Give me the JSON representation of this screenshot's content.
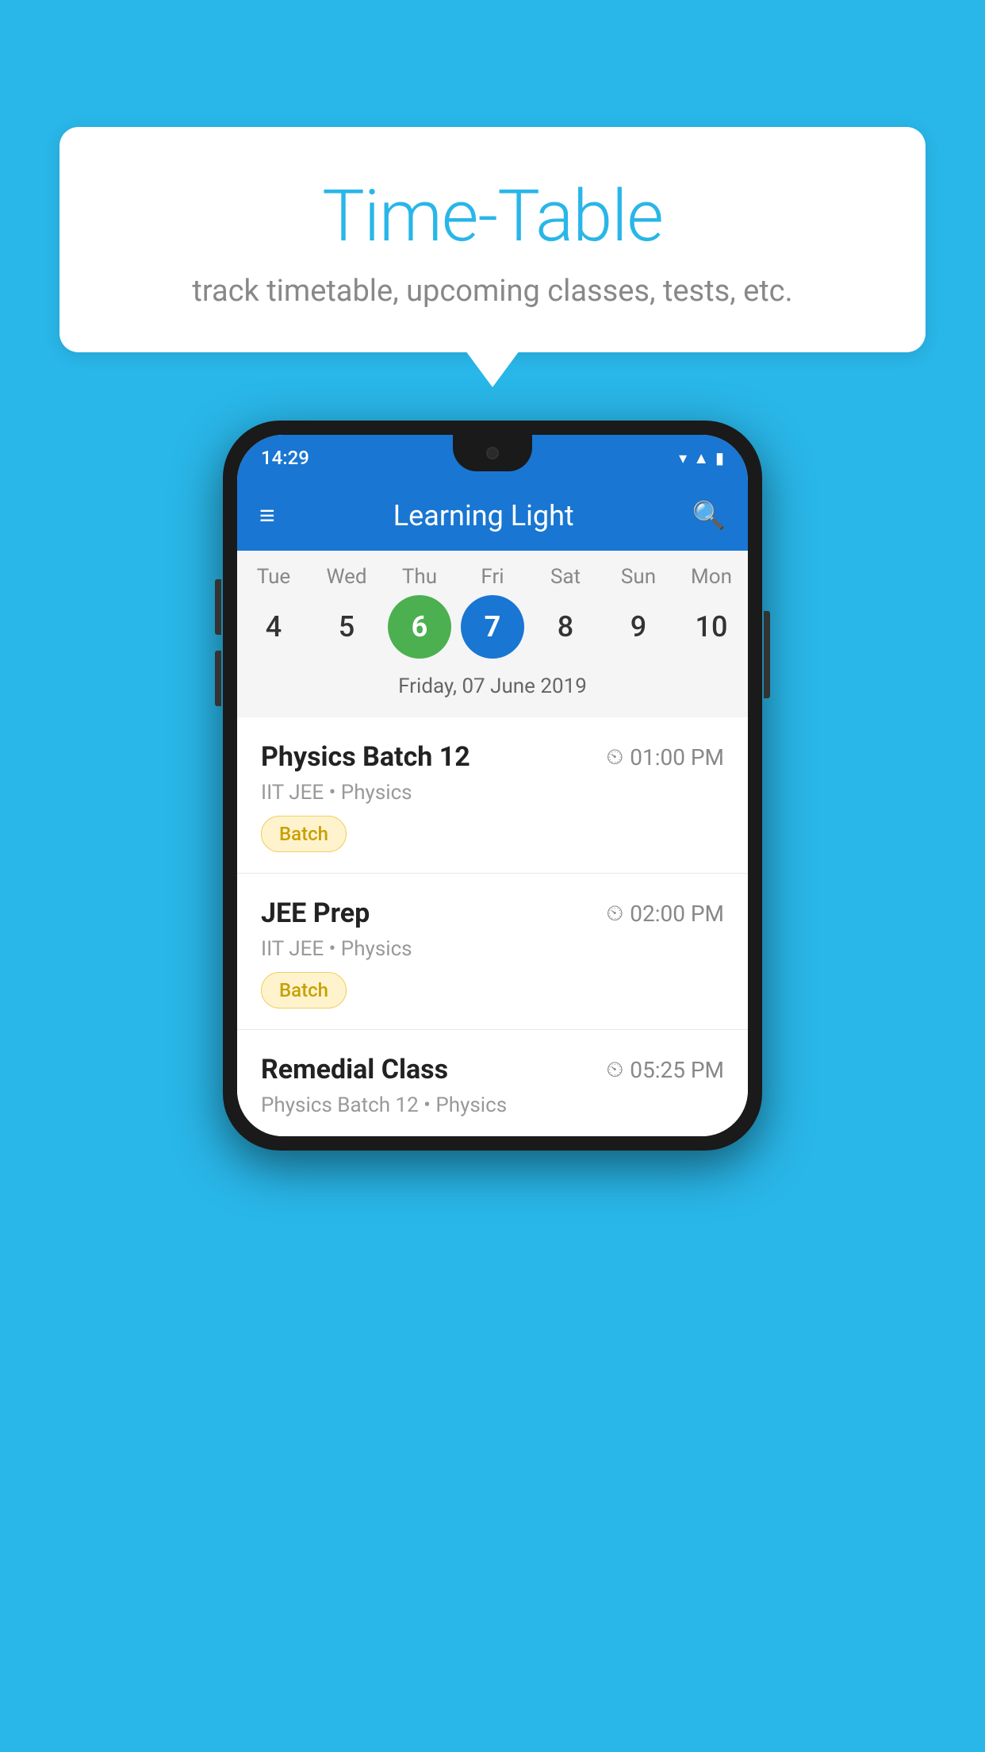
{
  "background_color": "#29B6E8",
  "speech_bubble": {
    "title": "Time-Table",
    "subtitle": "track timetable, upcoming classes, tests, etc."
  },
  "phone": {
    "status_bar": {
      "time": "14:29",
      "icons": [
        "wifi",
        "signal",
        "battery"
      ]
    },
    "app_bar": {
      "title": "Learning Light",
      "menu_icon": "☰",
      "search_icon": "🔍"
    },
    "calendar": {
      "days": [
        "Tue",
        "Wed",
        "Thu",
        "Fri",
        "Sat",
        "Sun",
        "Mon"
      ],
      "dates": [
        "4",
        "5",
        "6",
        "7",
        "8",
        "9",
        "10"
      ],
      "today_index": 2,
      "selected_index": 3,
      "selected_date_label": "Friday, 07 June 2019"
    },
    "schedule_items": [
      {
        "title": "Physics Batch 12",
        "time": "01:00 PM",
        "subtitle": "IIT JEE • Physics",
        "badge": "Batch"
      },
      {
        "title": "JEE Prep",
        "time": "02:00 PM",
        "subtitle": "IIT JEE • Physics",
        "badge": "Batch"
      },
      {
        "title": "Remedial Class",
        "time": "05:25 PM",
        "subtitle": "Physics Batch 12 • Physics",
        "badge": null
      }
    ]
  }
}
